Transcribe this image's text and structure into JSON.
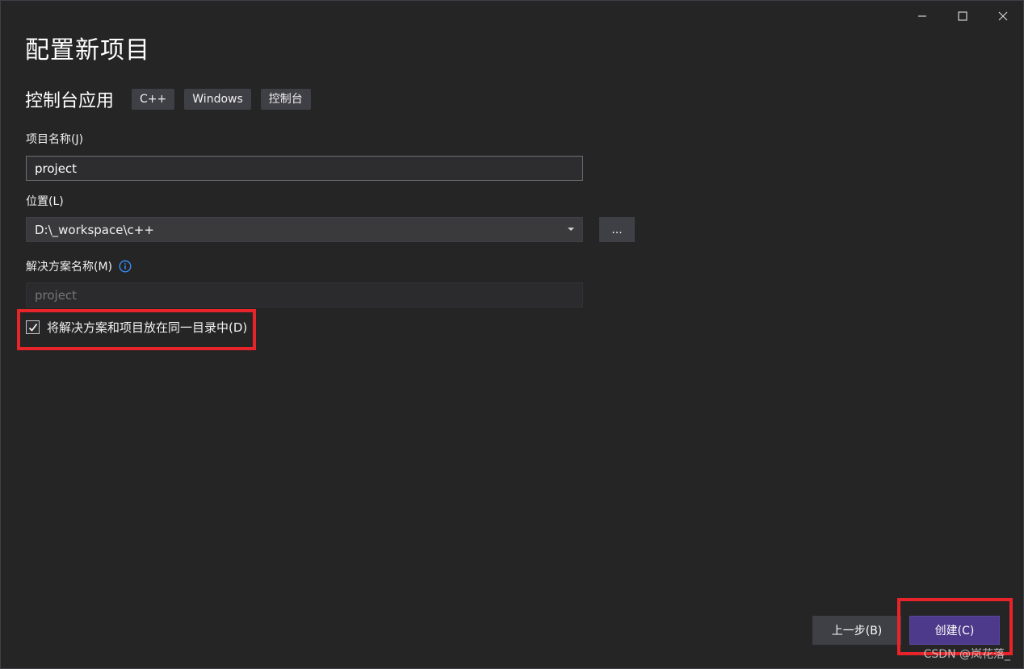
{
  "window": {
    "title": "配置新项目",
    "controls": {
      "minimize": "minimize-icon",
      "maximize": "maximize-icon",
      "close": "close-icon"
    }
  },
  "template": {
    "name": "控制台应用",
    "tags": [
      "C++",
      "Windows",
      "控制台"
    ]
  },
  "project_name": {
    "label": "项目名称(J)",
    "value": "project"
  },
  "location": {
    "label": "位置(L)",
    "value": "D:\\_workspace\\c++",
    "browse_label": "..."
  },
  "solution_name": {
    "label": "解决方案名称(M)",
    "info_icon": "info-icon",
    "placeholder": "project"
  },
  "same_dir_checkbox": {
    "label": "将解决方案和项目放在同一目录中(D)",
    "checked": true
  },
  "footer": {
    "back_label": "上一步(B)",
    "create_label": "创建(C)"
  },
  "watermark": "CSDN @岚花落_",
  "colors": {
    "background": "#252526",
    "create_button": "#4e3a8a",
    "highlight": "#e8242b",
    "info_icon": "#3794ff"
  }
}
